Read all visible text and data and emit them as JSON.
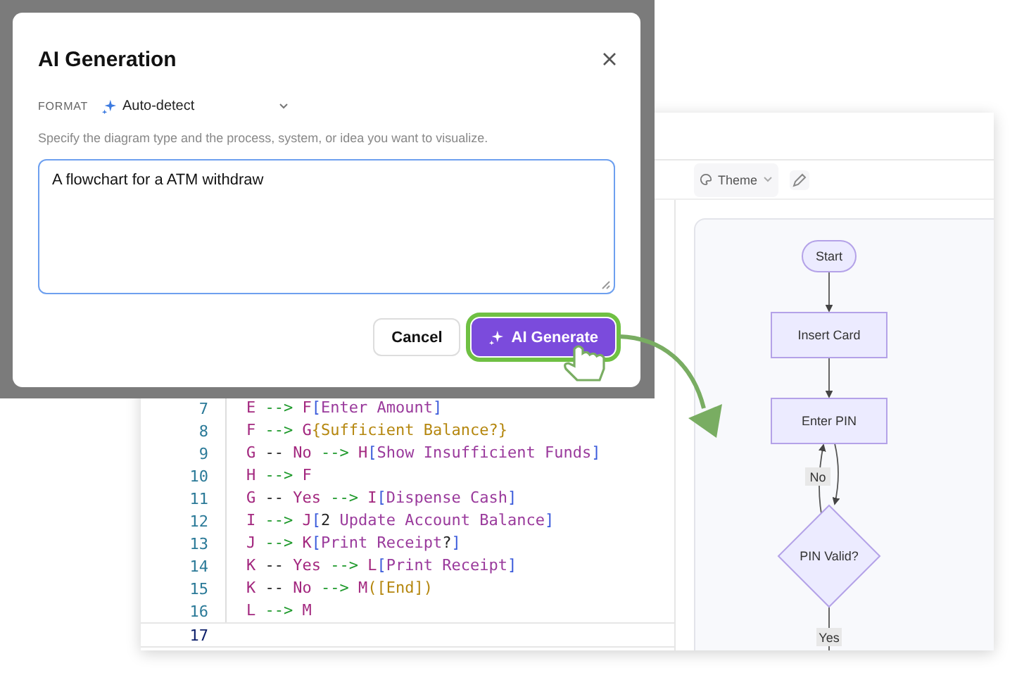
{
  "dialog": {
    "title": "AI Generation",
    "format_label": "FORMAT",
    "format_value": "Auto-detect",
    "hint": "Specify the diagram type and the process, system, or idea you want to visualize.",
    "prompt": "A flowchart for a ATM withdraw",
    "buttons": [
      {
        "label": "Cancel",
        "kind": "secondary",
        "highlighted": false
      },
      {
        "label": "AI Generate",
        "kind": "primary",
        "highlighted": true
      }
    ]
  },
  "editor": {
    "lines": [
      {
        "number": "7",
        "active": false,
        "tokens": [
          {
            "kind": "id",
            "text": "E"
          },
          {
            "kind": "arrow",
            "text": " --> "
          },
          {
            "kind": "id",
            "text": "F"
          },
          {
            "kind": "br",
            "text": "["
          },
          {
            "kind": "str",
            "text": "Enter Amount"
          },
          {
            "kind": "br",
            "text": "]"
          }
        ]
      },
      {
        "number": "8",
        "active": false,
        "tokens": [
          {
            "kind": "id",
            "text": "F"
          },
          {
            "kind": "arrow",
            "text": " --> "
          },
          {
            "kind": "id",
            "text": "G"
          },
          {
            "kind": "shape",
            "text": "{Sufficient Balance?}"
          }
        ]
      },
      {
        "number": "9",
        "active": false,
        "tokens": [
          {
            "kind": "id",
            "text": "G"
          },
          {
            "kind": "plain",
            "text": " -- "
          },
          {
            "kind": "id",
            "text": "No"
          },
          {
            "kind": "arrow",
            "text": " --> "
          },
          {
            "kind": "id",
            "text": "H"
          },
          {
            "kind": "br",
            "text": "["
          },
          {
            "kind": "str",
            "text": "Show Insufficient Funds"
          },
          {
            "kind": "br",
            "text": "]"
          }
        ]
      },
      {
        "number": "10",
        "active": false,
        "tokens": [
          {
            "kind": "id",
            "text": "H"
          },
          {
            "kind": "arrow",
            "text": " --> "
          },
          {
            "kind": "id",
            "text": "F"
          }
        ]
      },
      {
        "number": "11",
        "active": false,
        "tokens": [
          {
            "kind": "id",
            "text": "G"
          },
          {
            "kind": "plain",
            "text": " -- "
          },
          {
            "kind": "id",
            "text": "Yes"
          },
          {
            "kind": "arrow",
            "text": " --> "
          },
          {
            "kind": "id",
            "text": "I"
          },
          {
            "kind": "br",
            "text": "["
          },
          {
            "kind": "str",
            "text": "Dispense Cash"
          },
          {
            "kind": "br",
            "text": "]"
          }
        ]
      },
      {
        "number": "12",
        "active": false,
        "tokens": [
          {
            "kind": "id",
            "text": "I"
          },
          {
            "kind": "arrow",
            "text": " --> "
          },
          {
            "kind": "id",
            "text": "J"
          },
          {
            "kind": "br",
            "text": "["
          },
          {
            "kind": "plain",
            "text": "2"
          },
          {
            "kind": "str",
            "text": " Update Account Balance"
          },
          {
            "kind": "br",
            "text": "]"
          }
        ]
      },
      {
        "number": "13",
        "active": false,
        "tokens": [
          {
            "kind": "id",
            "text": "J"
          },
          {
            "kind": "arrow",
            "text": " --> "
          },
          {
            "kind": "id",
            "text": "K"
          },
          {
            "kind": "br",
            "text": "["
          },
          {
            "kind": "str",
            "text": "Print Receipt"
          },
          {
            "kind": "plain",
            "text": "?"
          },
          {
            "kind": "br",
            "text": "]"
          }
        ]
      },
      {
        "number": "14",
        "active": false,
        "tokens": [
          {
            "kind": "id",
            "text": "K"
          },
          {
            "kind": "plain",
            "text": " -- "
          },
          {
            "kind": "id",
            "text": "Yes"
          },
          {
            "kind": "arrow",
            "text": " --> "
          },
          {
            "kind": "id",
            "text": "L"
          },
          {
            "kind": "br",
            "text": "["
          },
          {
            "kind": "str",
            "text": "Print Receipt"
          },
          {
            "kind": "br",
            "text": "]"
          }
        ]
      },
      {
        "number": "15",
        "active": false,
        "tokens": [
          {
            "kind": "id",
            "text": "K"
          },
          {
            "kind": "plain",
            "text": " -- "
          },
          {
            "kind": "id",
            "text": "No"
          },
          {
            "kind": "arrow",
            "text": " --> "
          },
          {
            "kind": "id",
            "text": "M"
          },
          {
            "kind": "shape",
            "text": "([End])"
          }
        ]
      },
      {
        "number": "16",
        "active": false,
        "tokens": [
          {
            "kind": "id",
            "text": "L"
          },
          {
            "kind": "arrow",
            "text": " --> "
          },
          {
            "kind": "id",
            "text": "M"
          }
        ]
      },
      {
        "number": "17",
        "active": true
      }
    ]
  },
  "preview": {
    "theme_label": "Theme",
    "nodes": [
      {
        "kind": "stadium",
        "label": "Start"
      },
      {
        "kind": "rect",
        "label": "Insert Card"
      },
      {
        "kind": "rect",
        "label": "Enter PIN"
      },
      {
        "kind": "diamond",
        "label": "PIN Valid?"
      }
    ],
    "edge_labels": [
      "No",
      "Yes"
    ]
  }
}
